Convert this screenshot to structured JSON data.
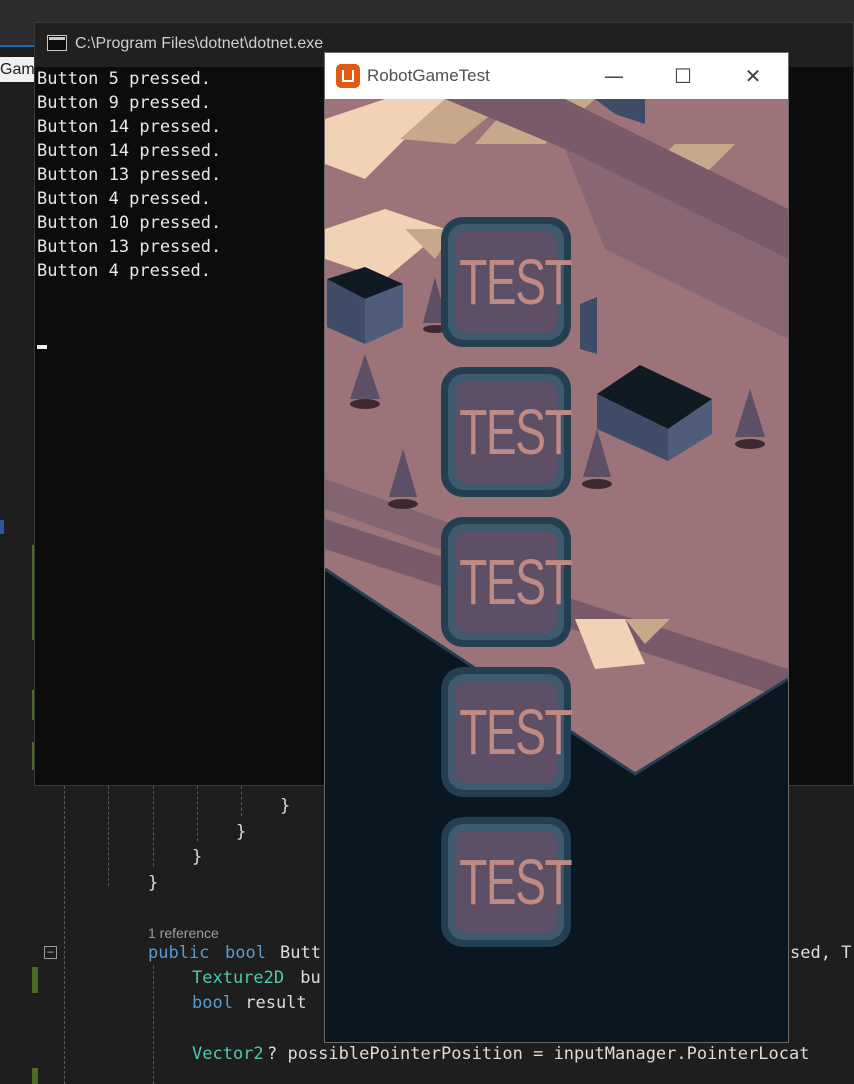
{
  "ide": {
    "tab_label": "Gam",
    "code_lines": [
      "}",
      "}",
      "}",
      "}"
    ],
    "reference_hint": "1 reference",
    "method_kw1": "public",
    "method_kw2": "bool",
    "method_name_fragment": "Butt",
    "method_tail": "sed, T",
    "line_tex_type": "Texture2D",
    "line_tex_rest": " bu",
    "line_bool_kw": "bool",
    "line_bool_rest": " result",
    "line_vec_type": "Vector2",
    "line_vec_rest": "? possiblePointerPosition = inputManager.PointerLocat",
    "collapse_glyph": "−"
  },
  "console": {
    "title": "C:\\Program Files\\dotnet\\dotnet.exe",
    "lines": [
      "Button 5 pressed.",
      "Button 9 pressed.",
      "Button 14 pressed.",
      "Button 14 pressed.",
      "Button 13 pressed.",
      "Button 4 pressed.",
      "Button 10 pressed.",
      "Button 13 pressed.",
      "Button 4 pressed."
    ]
  },
  "game": {
    "title": "RobotGameTest",
    "minimize_glyph": "—",
    "maximize_glyph": "☐",
    "close_glyph": "✕",
    "buttons": [
      "TEST",
      "TEST",
      "TEST",
      "TEST",
      "TEST"
    ]
  },
  "colors": {
    "ground": "#9c7378",
    "ground_light": "#f2d2b6",
    "ground_tan": "#c8a88a",
    "ground_dark": "#7a5a6a",
    "void": "#0a1620",
    "block_top": "#0f1a22",
    "block_side": "#3e4c68",
    "button_face": "#5c4f66",
    "button_text": "#c08a84",
    "button_frame": "#243e52"
  }
}
